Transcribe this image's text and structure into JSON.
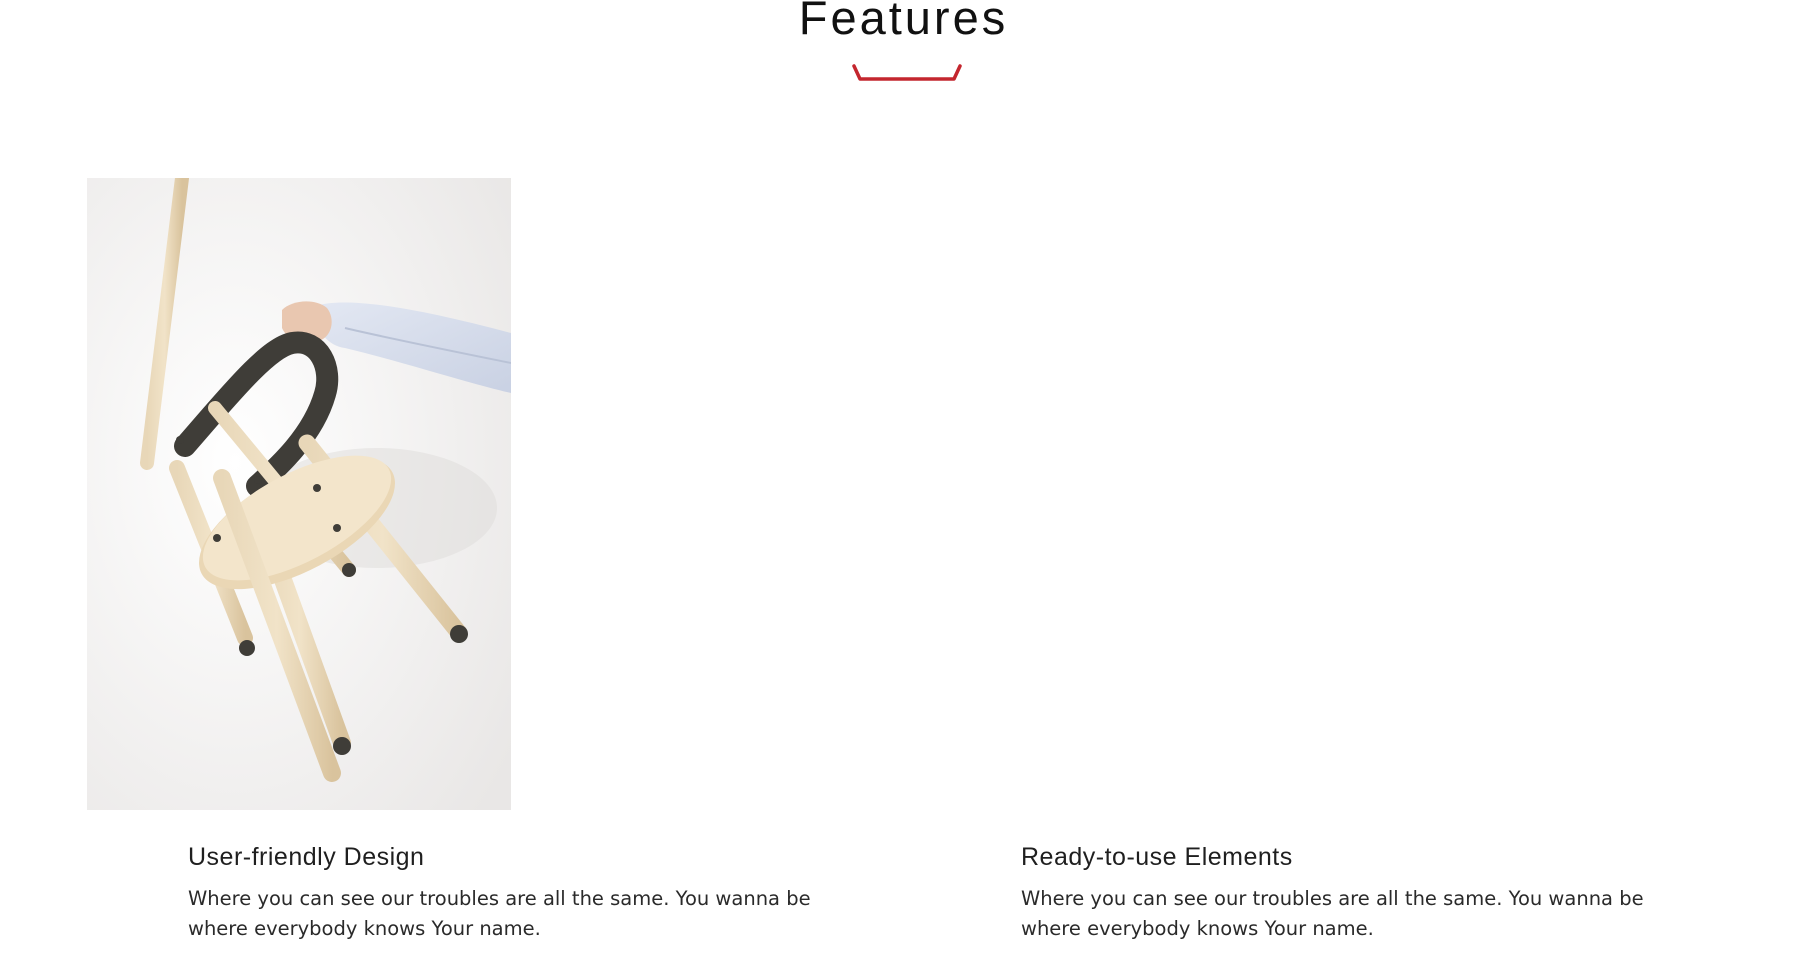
{
  "section": {
    "title": "Features",
    "accent_color": "#c4262e"
  },
  "image": {
    "alt": "wooden chair held by a hand"
  },
  "features": [
    {
      "title": "User-friendly Design",
      "text": "Where you can see our troubles are all the same. You wanna be where everybody knows Your name."
    },
    {
      "title": "Ready-to-use Elements",
      "text": "Where you can see our troubles are all the same. You wanna be where everybody knows Your name."
    }
  ]
}
